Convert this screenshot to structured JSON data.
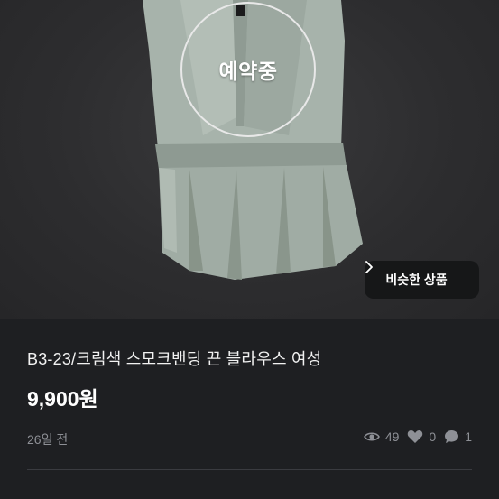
{
  "listing": {
    "reserved_badge": "예약중",
    "similar_button": "비슷한 상품",
    "title": "B3-23/크림색 스모크밴딩 끈 블라우스 여성",
    "price": "9,900원",
    "posted": "26일 전",
    "stats": {
      "views": "49",
      "likes": "0",
      "chats": "1"
    }
  },
  "icons": [
    "chevron-right-icon",
    "eye-icon",
    "heart-icon",
    "chat-bubble-icon"
  ],
  "colors": {
    "background": "#1e1f22",
    "badge_button": "#161718",
    "muted_text": "#8e9096"
  }
}
